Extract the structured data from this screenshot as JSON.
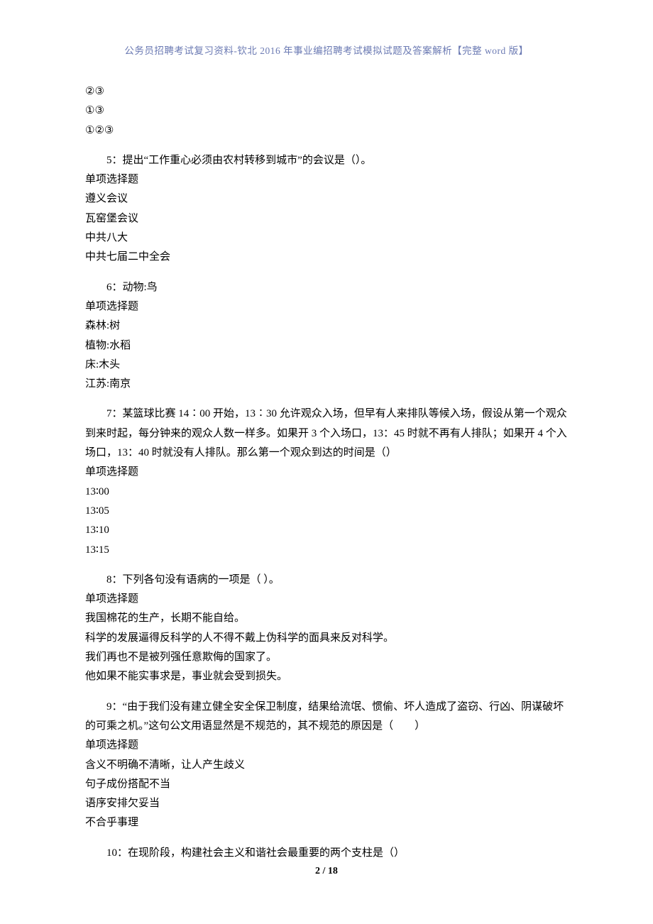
{
  "header": "公务员招聘考试复习资料-钦北 2016 年事业编招聘考试模拟试题及答案解析【完整 word 版】",
  "top_options": [
    "②③",
    "①③",
    "①②③"
  ],
  "questions": [
    {
      "num": "5",
      "text": "：提出“工作重心必须由农村转移到城市”的会议是（）。",
      "type": "单项选择题",
      "options": [
        "遵义会议",
        "瓦窑堡会议",
        "中共八大",
        "中共七届二中全会"
      ]
    },
    {
      "num": "6",
      "text": "：动物:鸟",
      "type": "单项选择题",
      "options": [
        "森林:树",
        "植物:水稻",
        "床:木头",
        "江苏:南京"
      ]
    },
    {
      "num": "7",
      "text": "：某篮球比赛 14∶00 开始，13∶30 允许观众入场，但早有人来排队等候入场，假设从第一个观众到来时起，每分钟来的观众人数一样多。如果开 3 个入场口，13：45 时就不再有人排队；如果开 4 个入场口，13：40 时就没有人排队。那么第一个观众到达的时间是（）",
      "type": "单项选择题",
      "options": [
        "13∶00",
        "13∶05",
        "13∶10",
        "13∶15"
      ]
    },
    {
      "num": "8",
      "text": "：下列各句没有语病的一项是（ ）。",
      "type": "单项选择题",
      "options": [
        "我国棉花的生产，长期不能自给。",
        "科学的发展逼得反科学的人不得不戴上伪科学的面具来反对科学。",
        "我们再也不是被列强任意欺侮的国家了。",
        "他如果不能实事求是，事业就会受到损失。"
      ]
    },
    {
      "num": "9",
      "text": "：“由于我们没有建立健全安全保卫制度，结果给流氓、惯偷、坏人造成了盗窃、行凶、阴谋破坏的可乘之机。”这句公文用语显然是不规范的，其不规范的原因是（　　）",
      "type": "单项选择题",
      "options": [
        "含义不明确不清晰，让人产生歧义",
        "句子成份搭配不当",
        "语序安排欠妥当",
        "不合乎事理"
      ]
    },
    {
      "num": "10",
      "text": "：在现阶段，构建社会主义和谐社会最重要的两个支柱是（）",
      "type": null,
      "options": []
    }
  ],
  "footer": "2 / 18"
}
